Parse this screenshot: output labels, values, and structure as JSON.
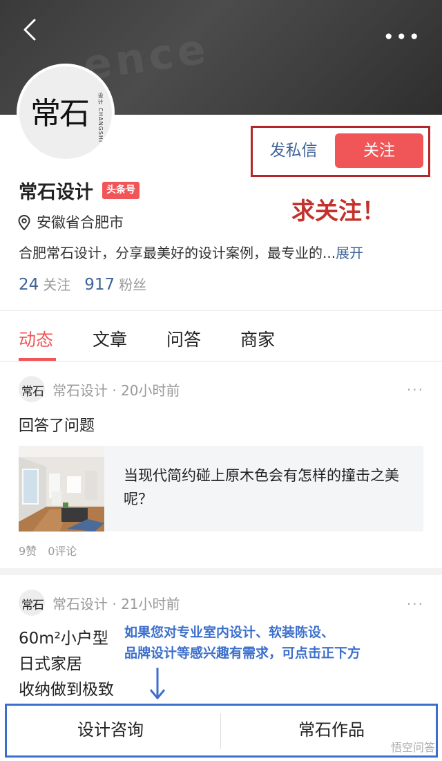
{
  "header": {
    "back_icon": "chevron-left-icon",
    "more_icon": "more-dots-icon",
    "more_glyph": "•••"
  },
  "profile": {
    "avatar_logo_text": "常石",
    "avatar_logo_sub": "设计 CHANGSHI",
    "name": "常石设计",
    "badge": "头条号",
    "location": "安徽省合肥市",
    "description": "合肥常石设计，分享最美好的设计案例，最专业的...",
    "description_more": "展开",
    "following_count": "24",
    "following_label": "关注",
    "followers_count": "917",
    "followers_label": "粉丝"
  },
  "actions": {
    "message_label": "发私信",
    "follow_label": "关注"
  },
  "annotations": {
    "red_text": "求关注！",
    "blue_text_line1": "如果您对专业室内设计、软装陈设、",
    "blue_text_line2": "品牌设计等感兴趣有需求，可点击正下方"
  },
  "tabs": [
    {
      "label": "动态",
      "active": true
    },
    {
      "label": "文章",
      "active": false
    },
    {
      "label": "问答",
      "active": false
    },
    {
      "label": "商家",
      "active": false
    }
  ],
  "posts": [
    {
      "author": "常石设计",
      "time": "20小时前",
      "meta": "常石设计 · 20小时前",
      "more": "···",
      "action": "回答了问题",
      "card_text": "当现代简约碰上原木色会有怎样的撞击之美呢？",
      "likes": "9赞",
      "comments": "0评论"
    },
    {
      "author": "常石设计",
      "time": "21小时前",
      "meta": "常石设计 · 21小时前",
      "more": "···",
      "title_line1": "60m²小户型",
      "title_line2": "日式家居",
      "title_line3": "收纳做到极致"
    }
  ],
  "bottom_bar": {
    "left_label": "设计咨询",
    "right_label": "常石作品"
  },
  "watermark": "悟空问答",
  "colors": {
    "accent_red": "#f05557",
    "link_blue": "#406599",
    "annotation_red": "#c3322c",
    "annotation_blue": "#3c6fcc"
  }
}
